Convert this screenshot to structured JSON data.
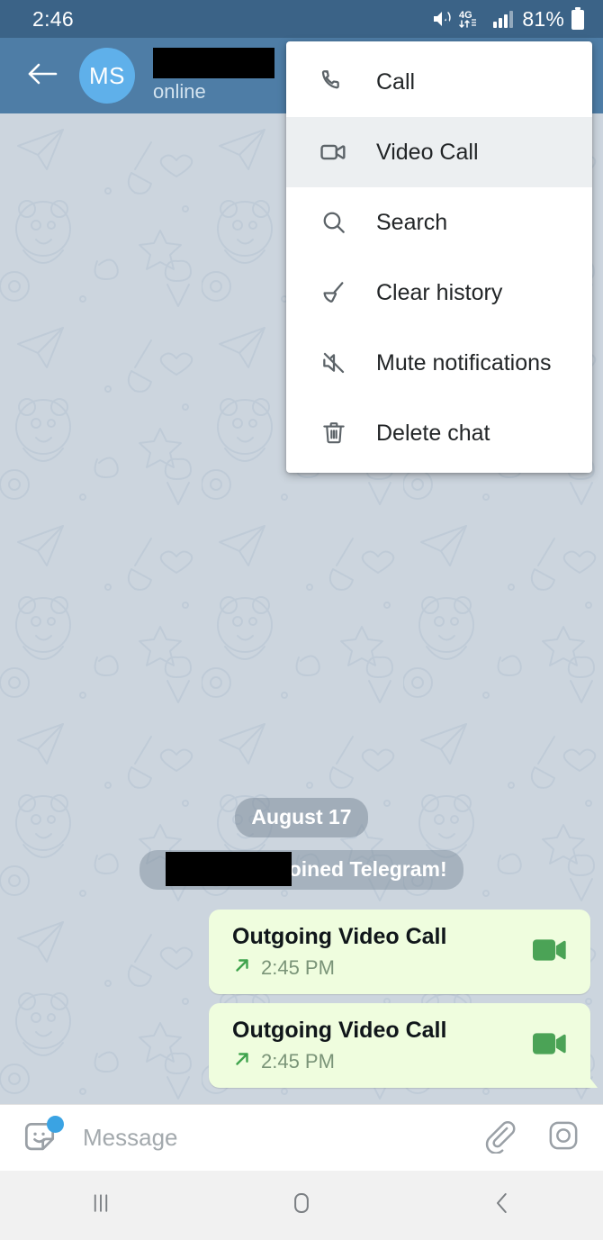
{
  "status_bar": {
    "clock": "2:46",
    "battery_percent": "81%",
    "icons": [
      "mute-vibrate-icon",
      "4g-lte-icon",
      "signal-bars-icon",
      "battery-icon"
    ],
    "network_label": "4G",
    "background_color": "#3b6387"
  },
  "app_bar": {
    "back_icon": "back-arrow-icon",
    "avatar_initials": "MS",
    "avatar_color": "#5fb0ea",
    "peer_name": "",
    "peer_name_redacted": true,
    "peer_status": "online",
    "background_color": "#4e7da6"
  },
  "popup_menu": {
    "items": [
      {
        "label": "Call",
        "icon": "phone-icon",
        "selected": false
      },
      {
        "label": "Video Call",
        "icon": "video-camera-icon",
        "selected": true
      },
      {
        "label": "Search",
        "icon": "search-icon",
        "selected": false
      },
      {
        "label": "Clear history",
        "icon": "broom-icon",
        "selected": false
      },
      {
        "label": "Mute notifications",
        "icon": "mute-bell-icon",
        "selected": false
      },
      {
        "label": "Delete chat",
        "icon": "trash-icon",
        "selected": false
      }
    ]
  },
  "chat": {
    "background_color": "#ccd5de",
    "date_badge": "August 17",
    "service_message": "joined Telegram!",
    "service_message_name_redacted": true,
    "messages": [
      {
        "title": "Outgoing Video Call",
        "time": "2:45 PM",
        "direction_icon": "outgoing-arrow-icon",
        "type_icon": "video-camera-icon",
        "bubble_color": "#effdde",
        "accent_color": "#4caf50",
        "tail": false
      },
      {
        "title": "Outgoing Video Call",
        "time": "2:45 PM",
        "direction_icon": "outgoing-arrow-icon",
        "type_icon": "video-camera-icon",
        "bubble_color": "#effdde",
        "accent_color": "#4caf50",
        "tail": true
      }
    ]
  },
  "input_bar": {
    "sticker_icon": "sticker-smiley-icon",
    "sticker_badge_color": "#3aa3e3",
    "placeholder": "Message",
    "attach_icon": "paperclip-icon",
    "camera_icon": "camera-icon"
  },
  "nav_bar": {
    "recents_icon": "recents-icon",
    "home_icon": "home-icon",
    "back_icon": "nav-back-icon"
  }
}
